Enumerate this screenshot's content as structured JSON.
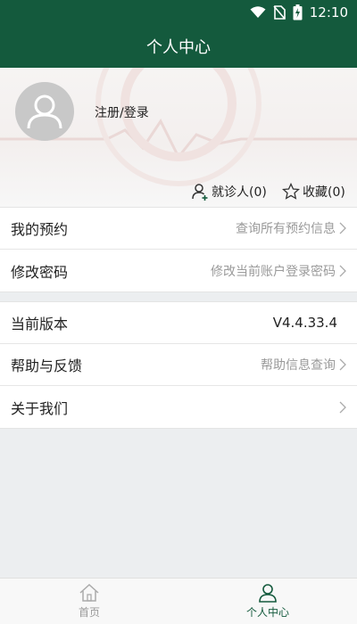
{
  "status_bar": {
    "time": "12:10",
    "icons": [
      "wifi-icon",
      "no-sim-icon",
      "battery-charging-icon"
    ]
  },
  "header": {
    "title": "个人中心"
  },
  "profile": {
    "login_text": "注册/登录",
    "patients_label": "就诊人(0)",
    "favorites_label": "收藏(0)"
  },
  "menu_group_1": [
    {
      "label": "我的预约",
      "value": "查询所有预约信息"
    },
    {
      "label": "修改密码",
      "value": "修改当前账户登录密码"
    }
  ],
  "menu_group_2": [
    {
      "label": "当前版本",
      "value": "V4.4.33.4"
    },
    {
      "label": "帮助与反馈",
      "value": "帮助信息查询"
    },
    {
      "label": "关于我们",
      "value": ""
    }
  ],
  "tabs": [
    {
      "label": "首页",
      "icon": "home-icon",
      "active": false
    },
    {
      "label": "个人中心",
      "icon": "user-icon",
      "active": true
    }
  ],
  "colors": {
    "primary": "#145a3d",
    "background": "#eceef0",
    "muted_text": "#9a9a9a"
  }
}
